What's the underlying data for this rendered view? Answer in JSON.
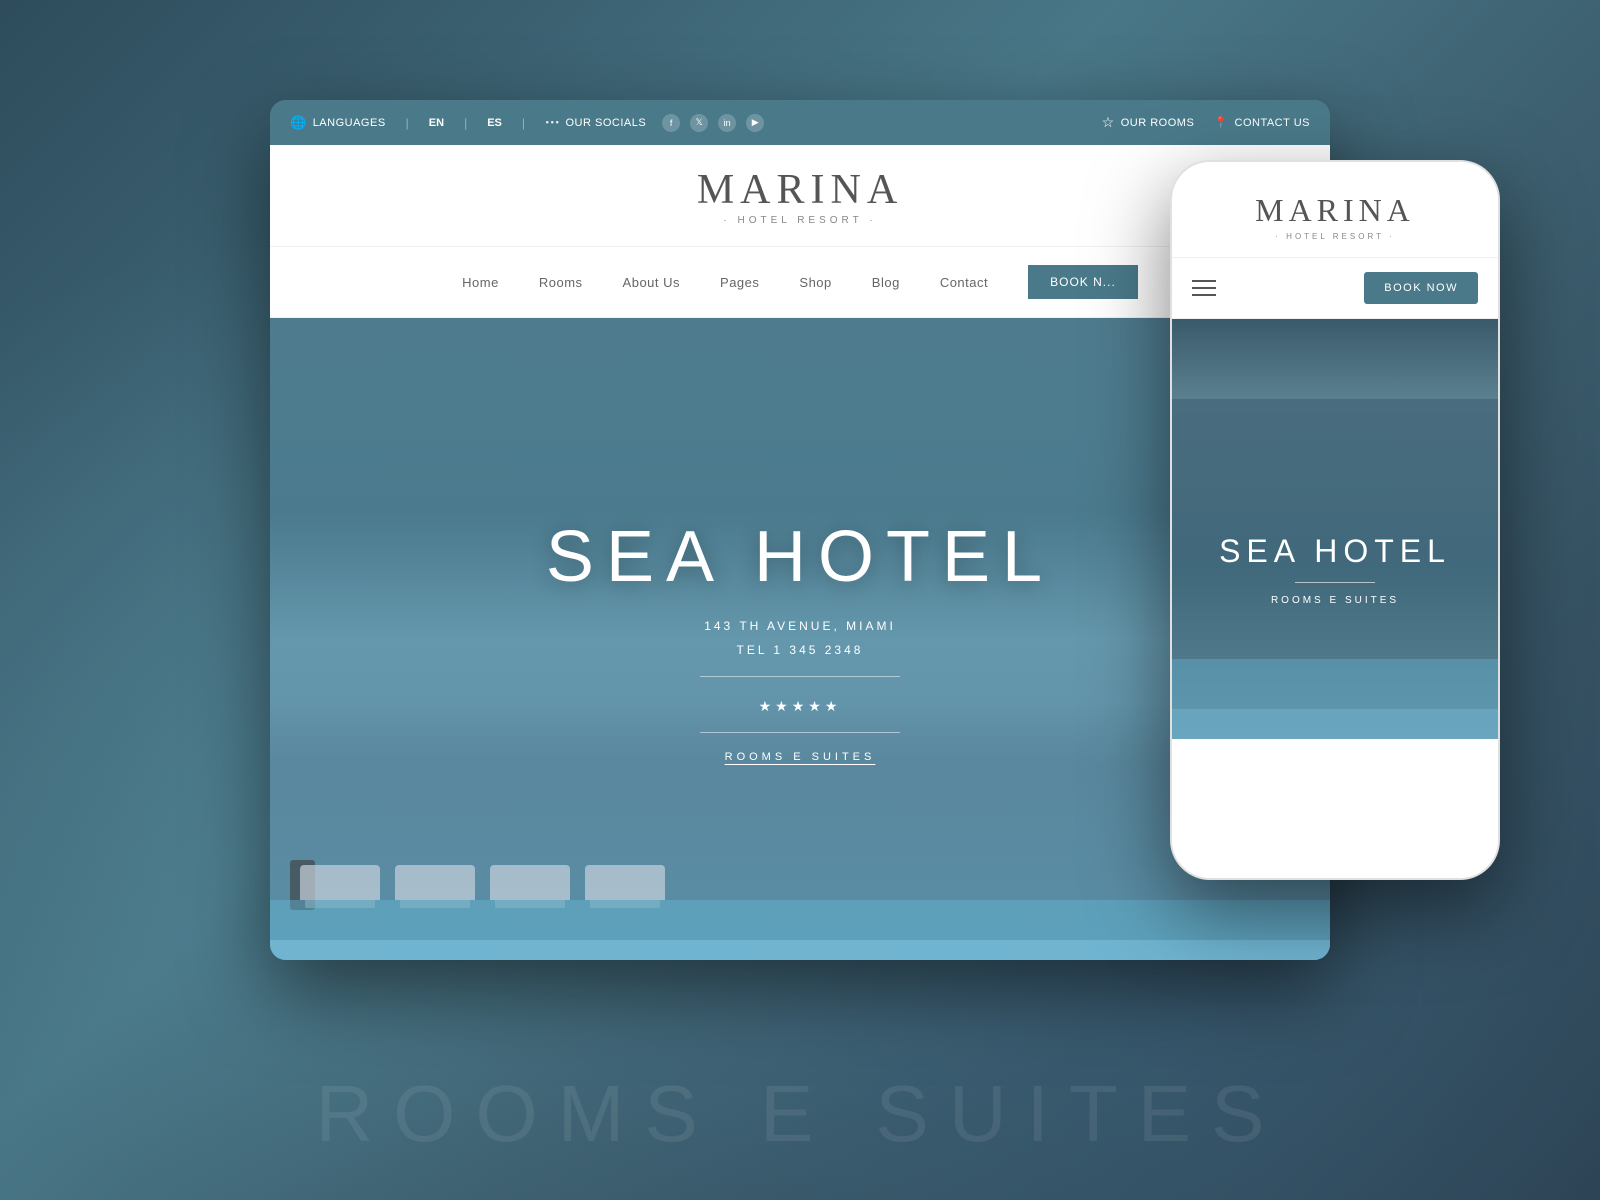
{
  "background": {
    "gradient_start": "#2c4a5a",
    "gradient_end": "#4a7a8a"
  },
  "topbar": {
    "languages_label": "LANGUAGES",
    "lang_en": "EN",
    "lang_es": "ES",
    "socials_label": "OUR SOCIALS",
    "social_items": [
      "f",
      "t",
      "in",
      "▶"
    ],
    "rooms_label": "OUR ROOMS",
    "contact_label": "CONTACT US"
  },
  "desktop": {
    "logo_main": "MARINA",
    "logo_sub": "· HOTEL RESORT ·",
    "nav_items": [
      "Home",
      "Rooms",
      "About Us",
      "Pages",
      "Shop",
      "Blog",
      "Contact"
    ],
    "book_btn": "BOOK N...",
    "hero_title": "SEA HOTEL",
    "hero_address_line1": "143 TH AVENUE, MIAMI",
    "hero_address_line2": "TEL 1 345 2348",
    "hero_stars": "★★★★★",
    "hero_cta": "ROOMS E SUITES"
  },
  "mobile": {
    "logo_main": "MARINA",
    "logo_sub": "· HOTEL RESORT ·",
    "book_btn": "BOOK NOW",
    "hero_title": "SEA HOTEL",
    "hero_cta": "ROOMS E SUITES"
  },
  "bg_text": "ROOMS E SUITES"
}
